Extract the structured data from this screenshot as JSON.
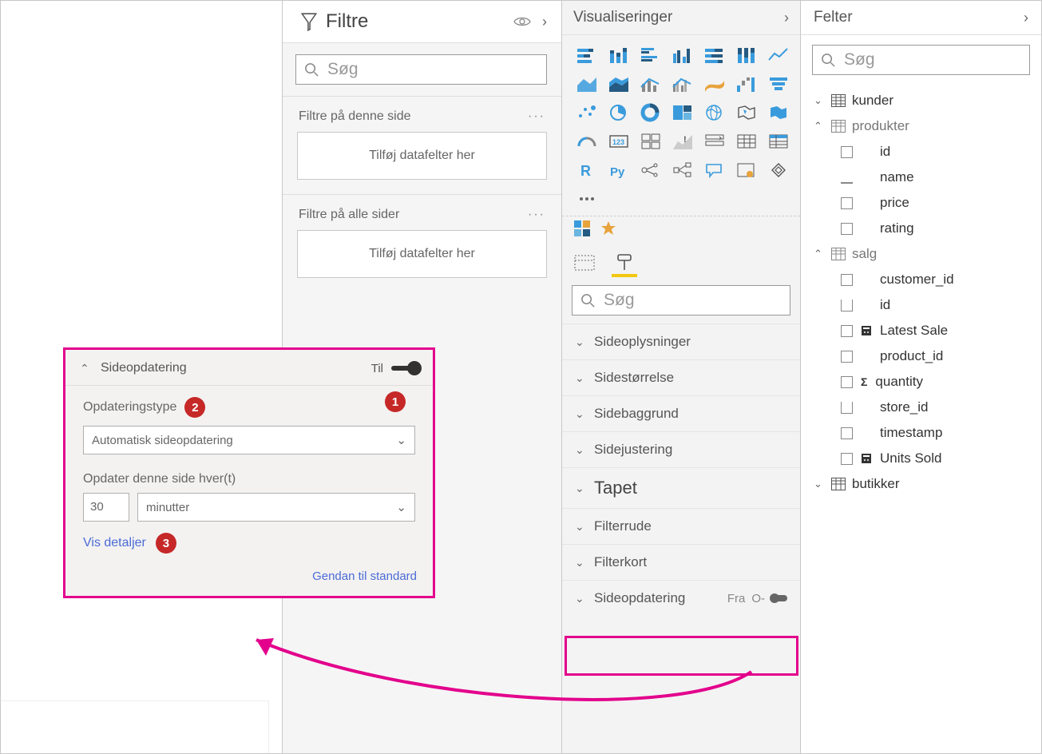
{
  "filters": {
    "title": "Filtre",
    "search_placeholder": "Søg",
    "section_page": "Filtre på denne side",
    "section_all": "Filtre på alle sider",
    "drop_hint": "Tilføj datafelter her"
  },
  "viz": {
    "title": "Visualiseringer",
    "search_placeholder": "Søg",
    "sections": {
      "pageinfo": "Sideoplysninger",
      "pagesize": "Sidestørrelse",
      "pagebg": "Sidebaggrund",
      "pagealign": "Sidejustering",
      "wallpaper": "Tapet",
      "filterpane": "Filterrude",
      "filtercard": "Filterkort",
      "refresh": "Sideopdatering",
      "refresh_state": "Fra"
    }
  },
  "fields": {
    "title": "Felter",
    "search_placeholder": "Søg",
    "tables": {
      "kunder": "kunder",
      "produkter": "produkter",
      "salg": "salg",
      "butikker": "butikker"
    },
    "produkter_cols": [
      "id",
      "name",
      "price",
      "rating"
    ],
    "salg_cols": [
      "customer_id",
      "id",
      "Latest Sale",
      "product_id",
      "quantity",
      "store_id",
      "timestamp",
      "Units Sold"
    ]
  },
  "callout": {
    "title": "Sideopdatering",
    "on_label": "Til",
    "type_label": "Opdateringstype",
    "type_value": "Automatisk sideopdatering",
    "interval_label": "Opdater denne side hver(t)",
    "interval_value": "30",
    "interval_unit": "minutter",
    "details": "Vis detaljer",
    "restore": "Gendan til standard",
    "badges": {
      "b1": "1",
      "b2": "2",
      "b3": "3"
    }
  }
}
